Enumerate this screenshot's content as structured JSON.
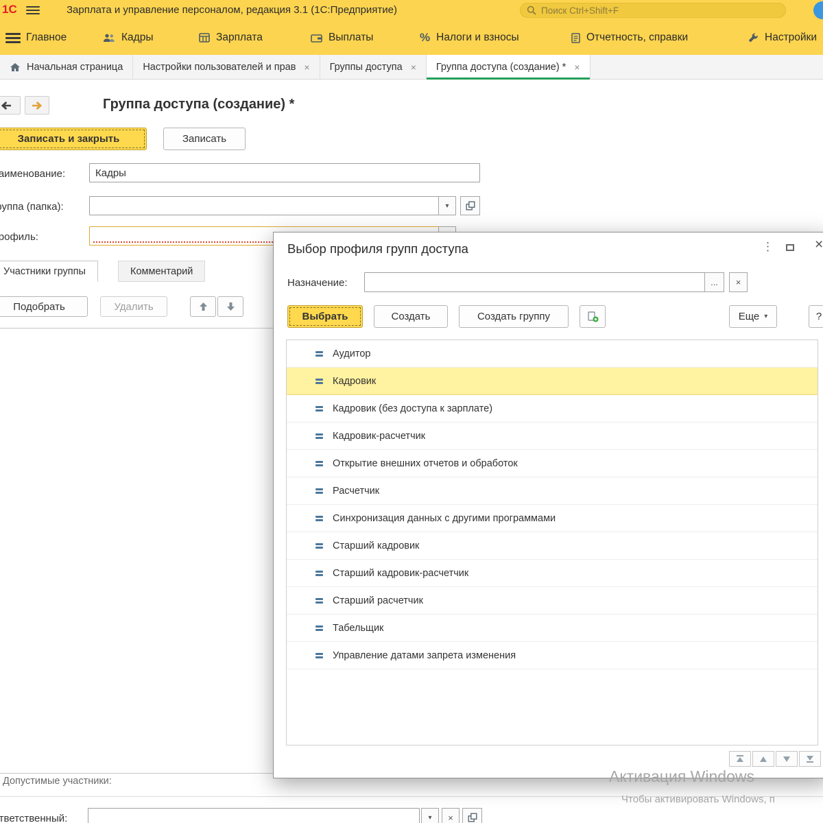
{
  "icons": {
    "dropdown": "▾",
    "close": "×",
    "ellipsis": "...",
    "kebab": "⋮"
  },
  "titlebar": {
    "logo": "1С",
    "app_title": "Зарплата и управление персоналом, редакция 3.1  (1С:Предприятие)",
    "search_text": "Поиск Ctrl+Shift+F"
  },
  "menubar": {
    "items": [
      {
        "label": "Главное"
      },
      {
        "label": "Кадры"
      },
      {
        "label": "Зарплата"
      },
      {
        "label": "Выплаты"
      },
      {
        "label": "Налоги и взносы"
      },
      {
        "label": "Отчетность, справки"
      },
      {
        "label": "Настройки"
      }
    ]
  },
  "tabbar": {
    "tabs": [
      {
        "label": "Начальная страница"
      },
      {
        "label": "Настройки пользователей и прав"
      },
      {
        "label": "Группы доступа"
      },
      {
        "label": "Группа доступа (создание) *"
      }
    ]
  },
  "form": {
    "title": "Группа доступа (создание) *",
    "buttons": {
      "save_close": "Записать и закрыть",
      "save": "Записать"
    },
    "name_label": "Наименование:",
    "name_value": "Кадры",
    "group_label": "Группа (папка):",
    "profile_label": "Профиль:",
    "tabs": {
      "members": "Участники группы",
      "comment": "Комментарий"
    },
    "member_buttons": {
      "pick": "Подобрать",
      "remove": "Удалить"
    },
    "allowed_label": "Допустимые участники:",
    "responsible_label": "Ответственный:"
  },
  "dialog": {
    "title": "Выбор профиля групп доступа",
    "assignment_label": "Назначение:",
    "buttons": {
      "select": "Выбрать",
      "create": "Создать",
      "create_group": "Создать группу",
      "more": "Еще",
      "help": "?"
    },
    "profiles": [
      "Аудитор",
      "Кадровик",
      "Кадровик (без доступа к зарплате)",
      "Кадровик-расчетчик",
      "Открытие внешних отчетов и обработок",
      "Расчетчик",
      "Синхронизация данных с другими программами",
      "Старший кадровик",
      "Старший кадровик-расчетчик",
      "Старший расчетчик",
      "Табельщик",
      "Управление датами запрета изменения"
    ],
    "selected_profile": "Кадровик"
  },
  "watermark": {
    "line1": "Активация Windows",
    "line2": "Чтобы активировать Windows, п"
  },
  "colors": {
    "brand_yellow": "#fcd44f",
    "active_tab_green": "#24a05a",
    "selection_yellow": "#fff2a0",
    "logo_red": "#e31e24",
    "required_red": "#e0442e"
  }
}
